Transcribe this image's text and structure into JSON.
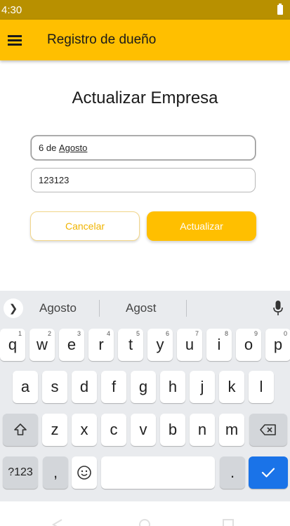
{
  "status_bar": {
    "time": "4:30"
  },
  "app_bar": {
    "title": "Registro de dueño"
  },
  "page": {
    "title": "Actualizar Empresa"
  },
  "form": {
    "field1_prefix": "6 de ",
    "field1_underlined": "Agosto",
    "field2_value": "123123"
  },
  "buttons": {
    "cancel_label": "Cancelar",
    "update_label": "Actualizar"
  },
  "keyboard": {
    "suggestions": [
      "Agosto",
      "Agost"
    ],
    "row1": [
      {
        "k": "q",
        "h": "1"
      },
      {
        "k": "w",
        "h": "2"
      },
      {
        "k": "e",
        "h": "3"
      },
      {
        "k": "r",
        "h": "4"
      },
      {
        "k": "t",
        "h": "5"
      },
      {
        "k": "y",
        "h": "6"
      },
      {
        "k": "u",
        "h": "7"
      },
      {
        "k": "i",
        "h": "8"
      },
      {
        "k": "o",
        "h": "9"
      },
      {
        "k": "p",
        "h": "0"
      }
    ],
    "row2": [
      "a",
      "s",
      "d",
      "f",
      "g",
      "h",
      "j",
      "k",
      "l"
    ],
    "row3": [
      "z",
      "x",
      "c",
      "v",
      "b",
      "n",
      "m"
    ],
    "symbols_label": "?123",
    "comma_label": ",",
    "period_label": "."
  },
  "colors": {
    "accent": "#ffbf00",
    "status_bar": "#b89000",
    "enter": "#1a73e8"
  }
}
